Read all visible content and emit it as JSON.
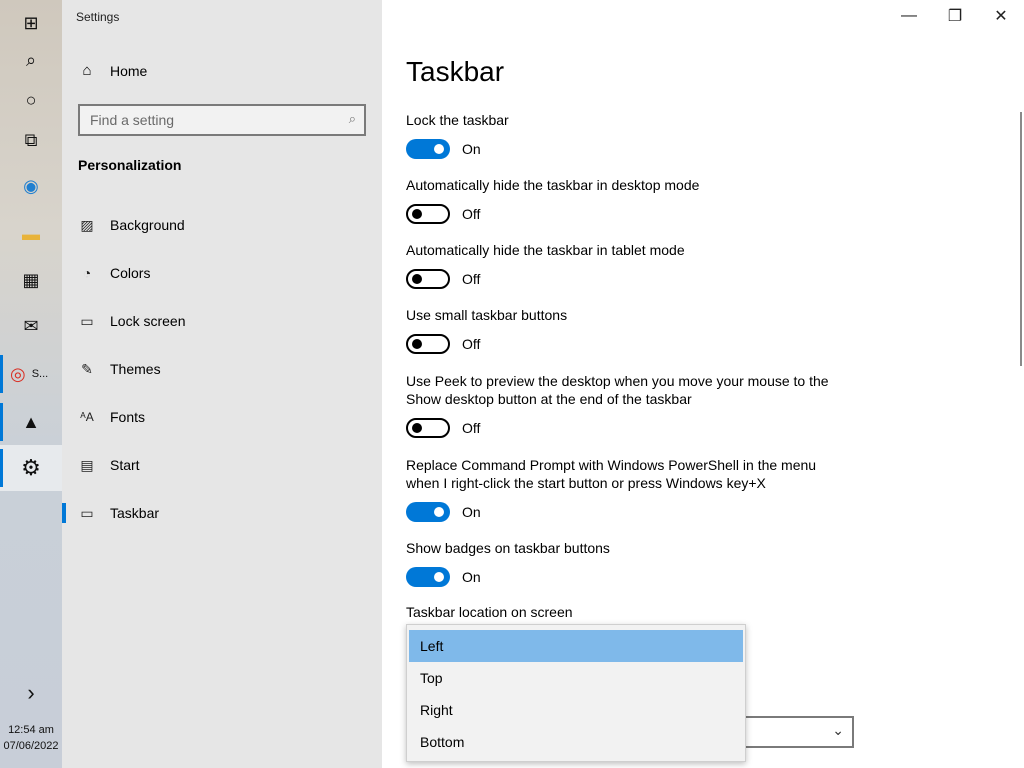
{
  "taskbar": {
    "items": [
      {
        "icon": "windows-start-icon",
        "glyph": "⊞"
      },
      {
        "icon": "search-icon",
        "glyph": "⌕"
      },
      {
        "icon": "cortana-icon",
        "glyph": "○"
      },
      {
        "icon": "task-view-icon",
        "glyph": "⧉"
      },
      {
        "icon": "edge-icon",
        "glyph": "◉"
      },
      {
        "icon": "file-explorer-icon",
        "glyph": "▬"
      },
      {
        "icon": "store-icon",
        "glyph": "▦"
      },
      {
        "icon": "mail-icon",
        "glyph": "✉"
      },
      {
        "icon": "chrome-icon",
        "glyph": "◎",
        "label": "S..."
      },
      {
        "icon": "photos-icon",
        "glyph": "▲"
      },
      {
        "icon": "settings-gear-icon",
        "glyph": "⚙"
      },
      {
        "icon": "show-more-chevron-icon",
        "glyph": "›"
      }
    ],
    "time": "12:54 am",
    "date": "07/06/2022"
  },
  "nav": {
    "app_title": "Settings",
    "home_label": "Home",
    "search_placeholder": "Find a setting",
    "section_title": "Personalization",
    "items": [
      {
        "label": "Background",
        "icon": "background-icon",
        "glyph": "▨"
      },
      {
        "label": "Colors",
        "icon": "palette-icon",
        "glyph": "◔"
      },
      {
        "label": "Lock screen",
        "icon": "lock-screen-icon",
        "glyph": "▭"
      },
      {
        "label": "Themes",
        "icon": "themes-icon",
        "glyph": "✎"
      },
      {
        "label": "Fonts",
        "icon": "fonts-icon",
        "glyph": "ᴬA"
      },
      {
        "label": "Start",
        "icon": "start-icon",
        "glyph": "▤"
      },
      {
        "label": "Taskbar",
        "icon": "taskbar-icon",
        "glyph": "▭"
      }
    ]
  },
  "content": {
    "title": "Taskbar",
    "settings": [
      {
        "label": "Lock the taskbar",
        "state": "On",
        "on": true
      },
      {
        "label": "Automatically hide the taskbar in desktop mode",
        "state": "Off",
        "on": false
      },
      {
        "label": "Automatically hide the taskbar in tablet mode",
        "state": "Off",
        "on": false
      },
      {
        "label": "Use small taskbar buttons",
        "state": "Off",
        "on": false
      },
      {
        "label_line1": "Use Peek to preview the desktop when you move your mouse to the",
        "label_line2": "Show desktop button at the end of the taskbar",
        "state": "Off",
        "on": false
      },
      {
        "label_line1": "Replace Command Prompt with Windows PowerShell in the menu",
        "label_line2": "when I right-click the start button or press Windows key+X",
        "state": "On",
        "on": true
      },
      {
        "label": "Show badges on taskbar buttons",
        "state": "On",
        "on": true
      }
    ],
    "location_label": "Taskbar location on screen",
    "location_options": [
      "Left",
      "Top",
      "Right",
      "Bottom"
    ],
    "location_selected": "Left",
    "accent_color": "#0078d7"
  }
}
